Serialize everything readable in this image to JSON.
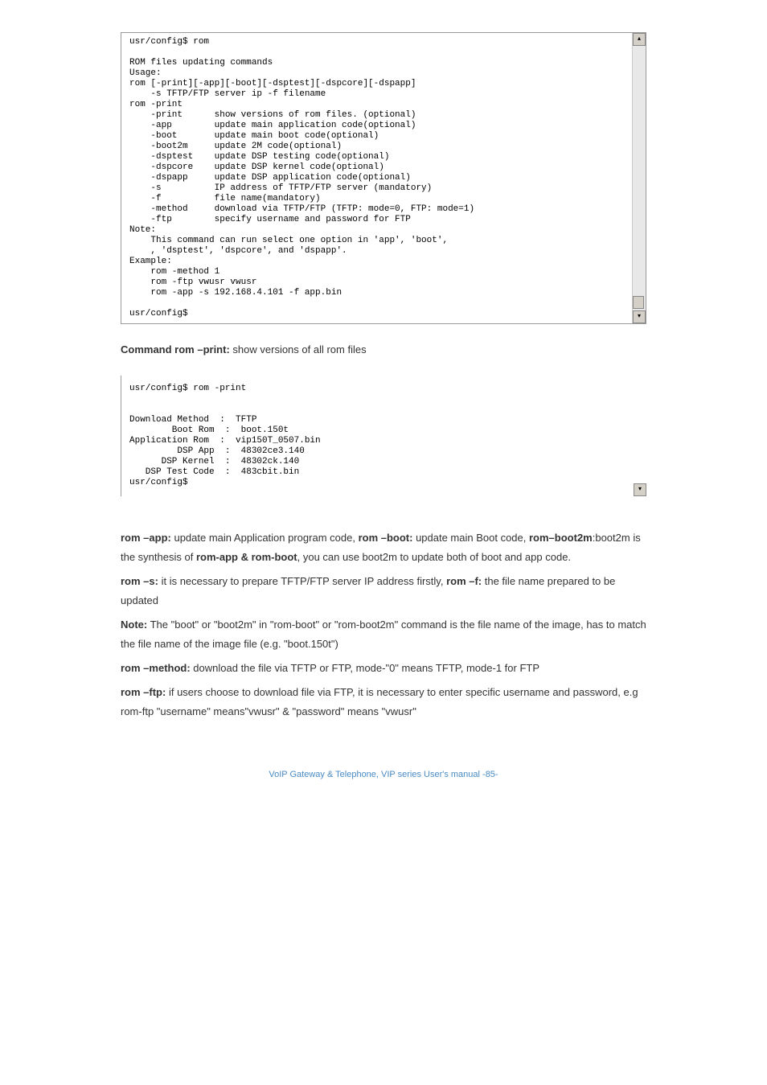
{
  "terminal1": {
    "text": "usr/config$ rom\n\nROM files updating commands\nUsage:\nrom [-print][-app][-boot][-dsptest][-dspcore][-dspapp]\n    -s TFTP/FTP server ip -f filename\nrom -print\n    -print      show versions of rom files. (optional)\n    -app        update main application code(optional)\n    -boot       update main boot code(optional)\n    -boot2m     update 2M code(optional)\n    -dsptest    update DSP testing code(optional)\n    -dspcore    update DSP kernel code(optional)\n    -dspapp     update DSP application code(optional)\n    -s          IP address of TFTP/FTP server (mandatory)\n    -f          file name(mandatory)\n    -method     download via TFTP/FTP (TFTP: mode=0, FTP: mode=1)\n    -ftp        specify username and password for FTP\nNote:\n    This command can run select one option in 'app', 'boot',\n    , 'dsptest', 'dspcore', and 'dspapp'.\nExample:\n    rom -method 1\n    rom -ftp vwusr vwusr\n    rom -app -s 192.168.4.101 -f app.bin\n\nusr/config$"
  },
  "section1": {
    "label": "Command rom –print:",
    "desc": "show versions of all rom files"
  },
  "terminal2": {
    "text": "usr/config$ rom -print\n\n\nDownload Method  :  TFTP\n        Boot Rom  :  boot.150t\nApplication Rom  :  vip150T_0507.bin\n         DSP App  :  48302ce3.140\n      DSP Kernel  :  48302ck.140\n   DSP Test Code  :  483cbit.bin\nusr/config$"
  },
  "instructions": {
    "line1a": "rom –app: ",
    "line1b": "update main Application program code, ",
    "line1c": "rom –boot: ",
    "line1d": "update main Boot code, ",
    "line1e": "rom–boot2m",
    "line1f": ":boot2m is ",
    "line1g": "the synthesis of ",
    "line1h": "rom-app & rom-boot",
    "line1i": ", you can use boot2m to update both of boot and app code.",
    "line2a": "rom –s: ",
    "line2b": "it is necessary to prepare TFTP/FTP server IP address firstly, ",
    "line2c": "rom –f:",
    "line2d": " the file name prepared to be updated",
    "line3": "Note:",
    "line3b": "The \"boot\" or \"boot2m\" in \"rom-boot\" or \"rom-boot2m\" command is the file name of the image, has to match the file name of the image file (e.g. \"boot.150t\")",
    "line4a": "rom –method: ",
    "line4b": "download the file via TFTP or FTP, mode-\"0\" means TFTP, mode-1 for FTP",
    "line5a": "rom –ftp: ",
    "line5b": "if users choose to download file via FTP, it is necessary to enter specific username and password, e.g rom-ftp \"username\" means\"vwusr\" & \"password\" means \"vwusr\""
  },
  "footer": {
    "text": "VoIP Gateway & Telephone, VIP series User's manual -85-"
  }
}
